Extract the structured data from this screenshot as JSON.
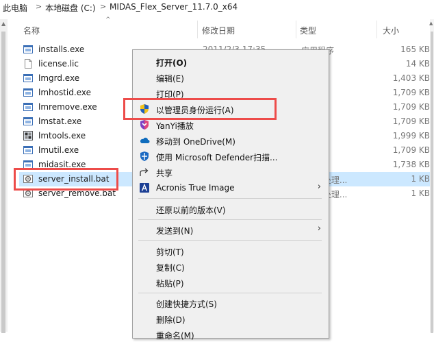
{
  "breadcrumb": [
    "此电脑",
    "本地磁盘 (C:)",
    "MIDAS_Flex_Server_11.7.0_x64"
  ],
  "breadcrumb_sep": ">",
  "columns": {
    "name": "名称",
    "date": "修改日期",
    "type": "类型",
    "size": "大小"
  },
  "files": [
    {
      "name": "installs.exe",
      "date": "2011/2/3 17:35",
      "type": "应用程序",
      "size": "165 KB",
      "icon": "exe-window-icon"
    },
    {
      "name": "license.lic",
      "date": "",
      "type": "",
      "size": "14 KB",
      "icon": "blank-document-icon"
    },
    {
      "name": "lmgrd.exe",
      "date": "",
      "type": "序",
      "size": "1,403 KB",
      "icon": "exe-window-icon"
    },
    {
      "name": "lmhostid.exe",
      "date": "",
      "type": "序",
      "size": "1,709 KB",
      "icon": "exe-window-icon"
    },
    {
      "name": "lmremove.exe",
      "date": "",
      "type": "",
      "size": "1,709 KB",
      "icon": "exe-window-icon"
    },
    {
      "name": "lmstat.exe",
      "date": "",
      "type": "序",
      "size": "1,709 KB",
      "icon": "exe-window-icon"
    },
    {
      "name": "lmtools.exe",
      "date": "",
      "type": "序",
      "size": "1,999 KB",
      "icon": "lmtools-app-icon"
    },
    {
      "name": "lmutil.exe",
      "date": "",
      "type": "序",
      "size": "1,709 KB",
      "icon": "exe-window-icon"
    },
    {
      "name": "midasit.exe",
      "date": "",
      "type": "序",
      "size": "1,738 KB",
      "icon": "exe-window-icon"
    },
    {
      "name": "server_install.bat",
      "date": "",
      "type": "ws 批处理...",
      "size": "1 KB",
      "icon": "batch-gear-icon",
      "selected": true
    },
    {
      "name": "server_remove.bat",
      "date": "",
      "type": "ws 批处理...",
      "size": "1 KB",
      "icon": "batch-gear-icon"
    }
  ],
  "context_menu": [
    {
      "label": "打开(O)",
      "bold": true,
      "icon": ""
    },
    {
      "label": "编辑(E)",
      "icon": ""
    },
    {
      "label": "打印(P)",
      "icon": ""
    },
    {
      "label": "以管理员身份运行(A)",
      "icon": "uac-shield-icon"
    },
    {
      "label": "YanYi播放",
      "icon": "yanyi-shield-icon"
    },
    {
      "label": "移动到 OneDrive(M)",
      "icon": "onedrive-cloud-icon"
    },
    {
      "label": "使用 Microsoft Defender扫描...",
      "icon": "defender-shield-icon"
    },
    {
      "label": "共享",
      "icon": "share-icon"
    },
    {
      "label": "Acronis True Image",
      "icon": "acronis-icon",
      "submenu": true
    },
    {
      "label": "还原以前的版本(V)",
      "icon": ""
    },
    {
      "label": "发送到(N)",
      "icon": "",
      "submenu": true
    },
    {
      "label": "剪切(T)",
      "icon": ""
    },
    {
      "label": "复制(C)",
      "icon": ""
    },
    {
      "label": "粘贴(P)",
      "icon": ""
    },
    {
      "label": "创建快捷方式(S)",
      "icon": ""
    },
    {
      "label": "删除(D)",
      "icon": ""
    },
    {
      "label": "重命名(M)",
      "icon": ""
    }
  ],
  "submenu_glyph": "›",
  "sort_glyph": "^",
  "colors": {
    "selection": "#cce8ff",
    "annotation_red": "#ed4c4a",
    "menu_bg": "#f0f0f0",
    "uac_blue": "#1f5fbf",
    "uac_yellow": "#f2c21b",
    "onedrive_blue": "#0f6cbd",
    "defender_blue": "#1c6ac2",
    "acronis_blue": "#1c3f94"
  }
}
